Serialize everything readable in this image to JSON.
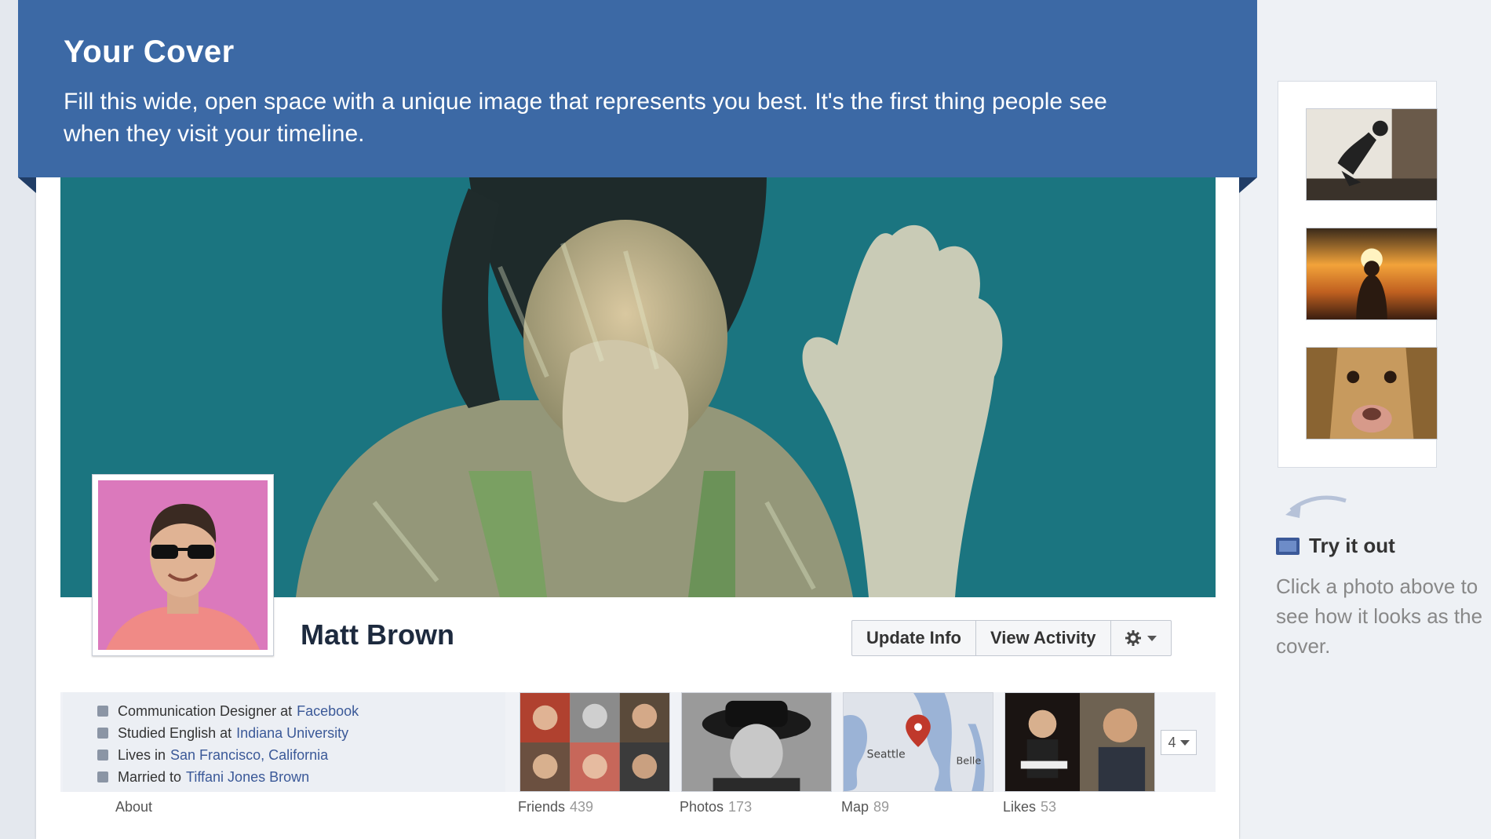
{
  "banner": {
    "title": "Your Cover",
    "text": "Fill this wide, open space with a unique image that represents you best. It's the first thing people see when they visit your timeline."
  },
  "profile": {
    "name": "Matt Brown"
  },
  "actions": {
    "update_info": "Update Info",
    "view_activity": "View Activity",
    "settings_icon": "gear-icon"
  },
  "about": {
    "lines": [
      {
        "prefix": "Communication Designer at",
        "link": "Facebook",
        "icon": "briefcase-icon"
      },
      {
        "prefix": "Studied English at",
        "link": "Indiana University",
        "icon": "graduation-cap-icon"
      },
      {
        "prefix": "Lives in",
        "link": "San Francisco, California",
        "icon": "home-icon"
      },
      {
        "prefix": "Married to",
        "link": "Tiffani Jones Brown",
        "icon": "heart-icon"
      }
    ],
    "label": "About"
  },
  "tabs": [
    {
      "label": "Friends",
      "count": "439"
    },
    {
      "label": "Photos",
      "count": "173"
    },
    {
      "label": "Map",
      "count": "89"
    },
    {
      "label": "Likes",
      "count": "53"
    }
  ],
  "map": {
    "city1": "Seattle",
    "city2": "Belle"
  },
  "more": {
    "count": "4"
  },
  "sidebar": {
    "try_title": "Try it out",
    "try_text": "Click a photo above to see how it looks as the cover."
  },
  "colors": {
    "banner": "#3c69a5",
    "link": "#3b5998",
    "cover_water": "#1f7a84",
    "profile_bg": "#d774b8"
  }
}
